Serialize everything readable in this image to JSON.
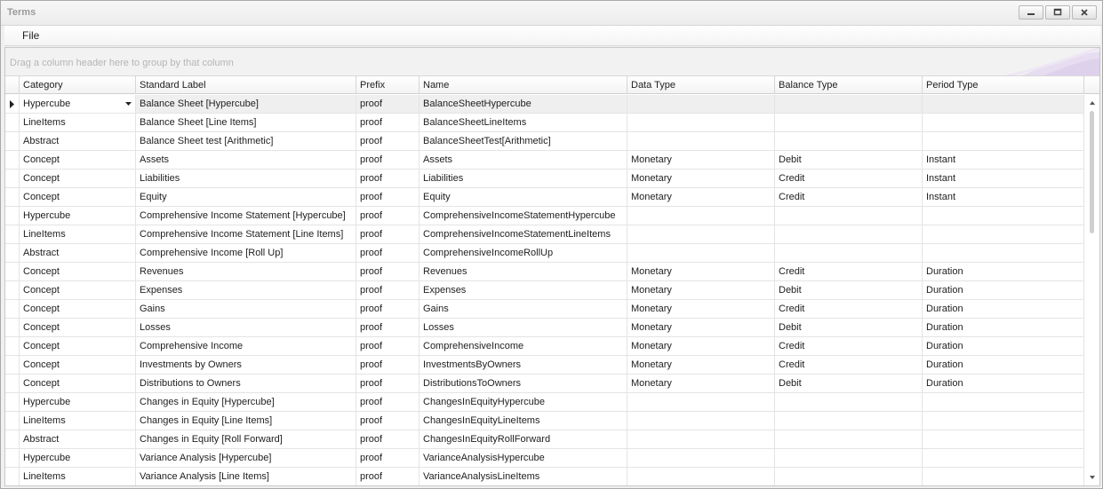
{
  "window": {
    "title": "Terms"
  },
  "menu": {
    "file": "File"
  },
  "grid": {
    "group_hint": "Drag a column header here to group by that column",
    "columns": [
      "Category",
      "Standard Label",
      "Prefix",
      "Name",
      "Data Type",
      "Balance Type",
      "Period Type"
    ],
    "rows": [
      [
        "Hypercube",
        "Balance Sheet [Hypercube]",
        "proof",
        "BalanceSheetHypercube",
        "",
        "",
        ""
      ],
      [
        "LineItems",
        "Balance Sheet [Line Items]",
        "proof",
        "BalanceSheetLineItems",
        "",
        "",
        ""
      ],
      [
        "Abstract",
        "Balance Sheet test [Arithmetic]",
        "proof",
        "BalanceSheetTest[Arithmetic]",
        "",
        "",
        ""
      ],
      [
        "Concept",
        "Assets",
        "proof",
        "Assets",
        "Monetary",
        "Debit",
        "Instant"
      ],
      [
        "Concept",
        "Liabilities",
        "proof",
        "Liabilities",
        "Monetary",
        "Credit",
        "Instant"
      ],
      [
        "Concept",
        "Equity",
        "proof",
        "Equity",
        "Monetary",
        "Credit",
        "Instant"
      ],
      [
        "Hypercube",
        "Comprehensive Income Statement [Hypercube]",
        "proof",
        "ComprehensiveIncomeStatementHypercube",
        "",
        "",
        ""
      ],
      [
        "LineItems",
        "Comprehensive Income Statement [Line Items]",
        "proof",
        "ComprehensiveIncomeStatementLineItems",
        "",
        "",
        ""
      ],
      [
        "Abstract",
        "Comprehensive Income [Roll Up]",
        "proof",
        "ComprehensiveIncomeRollUp",
        "",
        "",
        ""
      ],
      [
        "Concept",
        "Revenues",
        "proof",
        "Revenues",
        "Monetary",
        "Credit",
        "Duration"
      ],
      [
        "Concept",
        "Expenses",
        "proof",
        "Expenses",
        "Monetary",
        "Debit",
        "Duration"
      ],
      [
        "Concept",
        "Gains",
        "proof",
        "Gains",
        "Monetary",
        "Credit",
        "Duration"
      ],
      [
        "Concept",
        "Losses",
        "proof",
        "Losses",
        "Monetary",
        "Debit",
        "Duration"
      ],
      [
        "Concept",
        "Comprehensive Income",
        "proof",
        "ComprehensiveIncome",
        "Monetary",
        "Credit",
        "Duration"
      ],
      [
        "Concept",
        "Investments by Owners",
        "proof",
        "InvestmentsByOwners",
        "Monetary",
        "Credit",
        "Duration"
      ],
      [
        "Concept",
        "Distributions to Owners",
        "proof",
        "DistributionsToOwners",
        "Monetary",
        "Debit",
        "Duration"
      ],
      [
        "Hypercube",
        "Changes in Equity [Hypercube]",
        "proof",
        "ChangesInEquityHypercube",
        "",
        "",
        ""
      ],
      [
        "LineItems",
        "Changes in Equity [Line Items]",
        "proof",
        "ChangesInEquityLineItems",
        "",
        "",
        ""
      ],
      [
        "Abstract",
        "Changes in Equity [Roll Forward]",
        "proof",
        "ChangesInEquityRollForward",
        "",
        "",
        ""
      ],
      [
        "Hypercube",
        "Variance Analysis [Hypercube]",
        "proof",
        "VarianceAnalysisHypercube",
        "",
        "",
        ""
      ],
      [
        "LineItems",
        "Variance Analysis  [Line Items]",
        "proof",
        "VarianceAnalysisLineItems",
        "",
        "",
        ""
      ]
    ],
    "selected_row": 0
  },
  "icons": {
    "minimize": "minimize-icon",
    "maximize": "maximize-icon",
    "close": "close-icon",
    "row_indicator": "row-pointer-icon",
    "dropdown": "chevron-down-icon"
  },
  "colors": {
    "selected_row": "#efefef",
    "grid_line": "#e4e4e4",
    "header_bg": "#f3f3f3"
  }
}
